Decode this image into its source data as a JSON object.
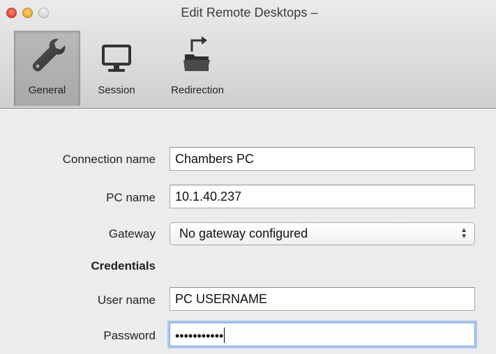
{
  "window": {
    "title": "Edit Remote Desktops –"
  },
  "toolbar": {
    "items": [
      {
        "label": "General",
        "icon": "wrench-icon",
        "selected": true
      },
      {
        "label": "Session",
        "icon": "monitor-icon",
        "selected": false
      },
      {
        "label": "Redirection",
        "icon": "folder-redirect-icon",
        "selected": false
      }
    ]
  },
  "form": {
    "connection_name": {
      "label": "Connection name",
      "value": "Chambers PC"
    },
    "pc_name": {
      "label": "PC name",
      "value": "10.1.40.237"
    },
    "gateway": {
      "label": "Gateway",
      "value": "No gateway configured"
    },
    "credentials_heading": "Credentials",
    "user_name": {
      "label": "User name",
      "value": "PC USERNAME"
    },
    "password": {
      "label": "Password",
      "value": "•••••••••••"
    }
  }
}
